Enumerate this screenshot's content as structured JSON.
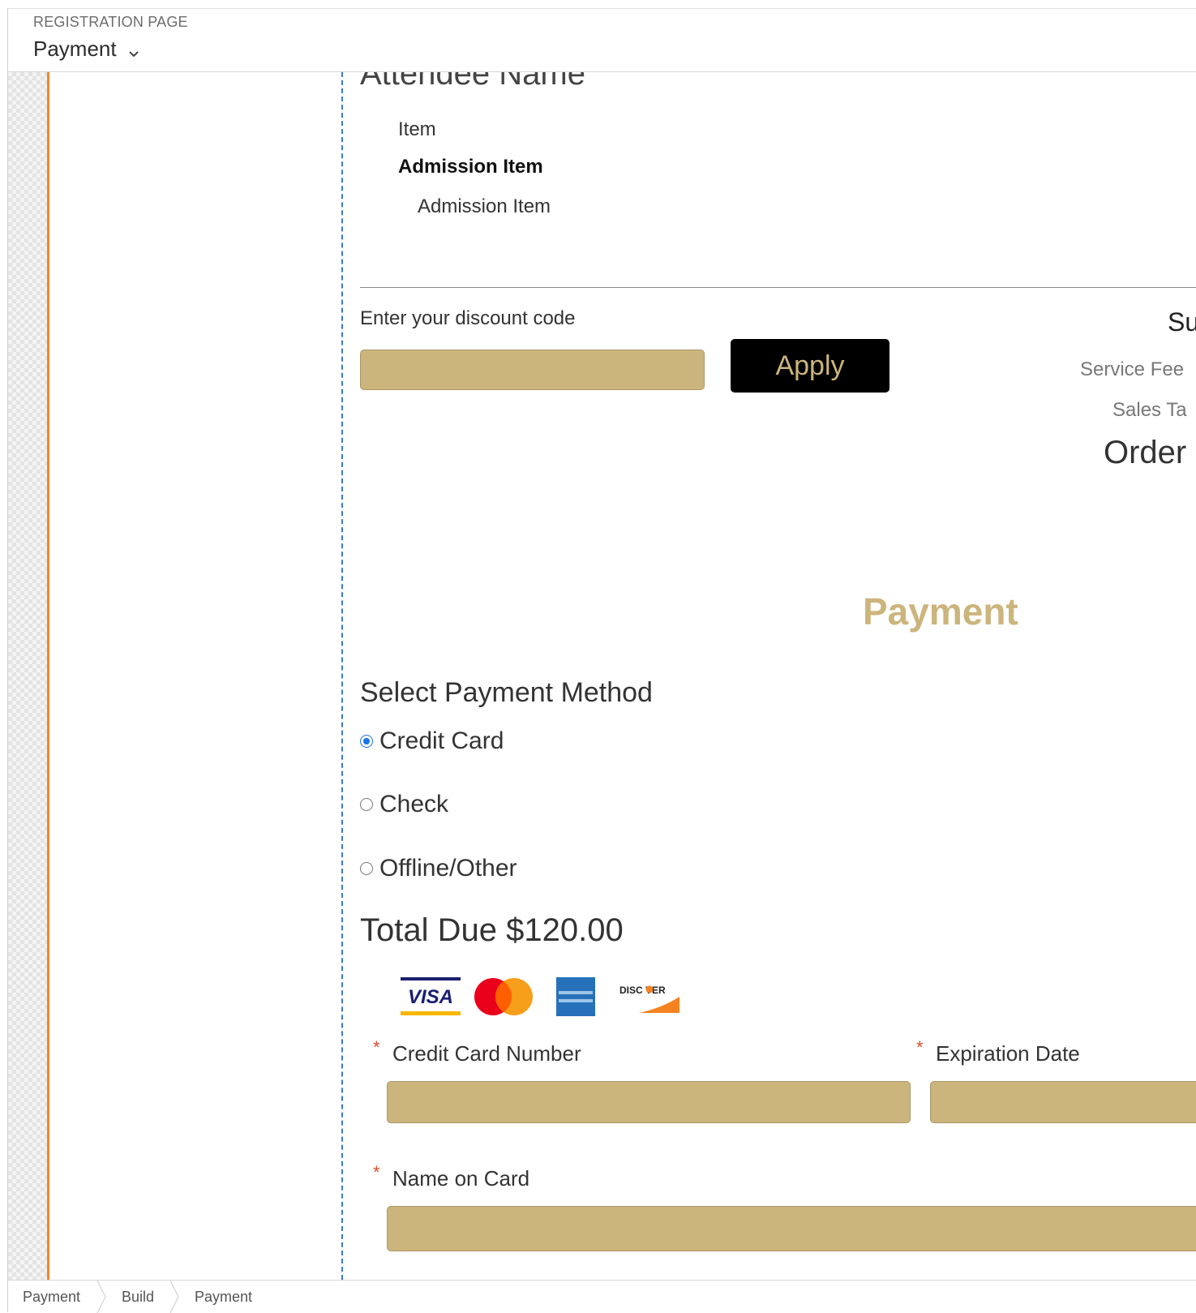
{
  "header": {
    "kicker": "REGISTRATION PAGE",
    "page_select": "Payment"
  },
  "form": {
    "attendee_heading": "Attendee Name",
    "item_label": "Item",
    "item_title": "Admission Item",
    "item_subtitle": "Admission Item",
    "discount_label": "Enter your discount code",
    "discount_value": "",
    "apply_label": "Apply"
  },
  "summary": {
    "heading": "Su",
    "service_fee": "Service Fee",
    "sales_tax": "Sales Ta",
    "order": "Order"
  },
  "payment": {
    "title": "Payment",
    "select_method_label": "Select Payment Method",
    "methods": [
      {
        "label": "Credit Card",
        "checked": true
      },
      {
        "label": "Check",
        "checked": false
      },
      {
        "label": "Offline/Other",
        "checked": false
      }
    ],
    "total_due": "Total Due $120.00",
    "card_logos": [
      "visa-logo",
      "mastercard-logo",
      "american-express-logo",
      "discover-logo"
    ],
    "card_logo_text": {
      "visa": "VISA",
      "discover": "DISC VER"
    },
    "fields": {
      "card_number_label": "Credit Card Number",
      "expiration_label": "Expiration Date",
      "name_label": "Name on Card",
      "required_mark": "*"
    }
  },
  "breadcrumb": [
    "Payment",
    "Build",
    "Payment"
  ],
  "colors": {
    "accent_gold": "#ccb57c",
    "orange_edge": "#f3862a",
    "drop_zone_blue": "#3a78d8",
    "button_bg": "#000000",
    "radio_checked": "#1a73e8"
  }
}
